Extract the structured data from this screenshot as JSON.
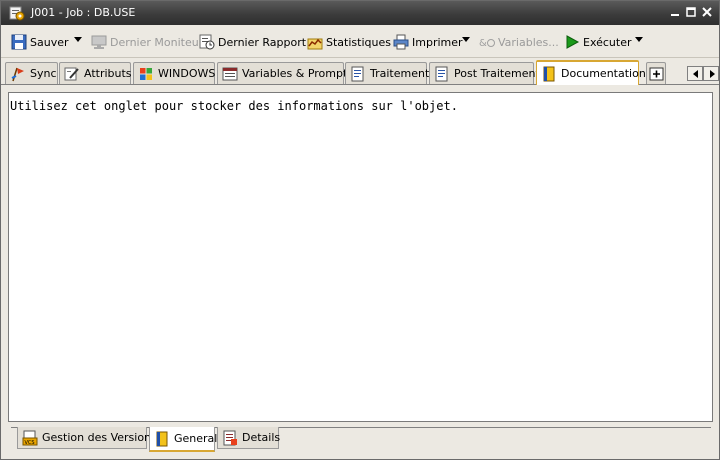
{
  "window": {
    "title": "J001 - Job : DB.USE",
    "controls": [
      "minimize",
      "maximize",
      "close"
    ]
  },
  "toolbar": {
    "save": "Sauver",
    "last_monitor": "Dernier Moniteur",
    "last_report": "Dernier Rapport",
    "statistics": "Statistiques",
    "print": "Imprimer",
    "variables": "Variables...",
    "execute": "Exécuter"
  },
  "tabs": [
    {
      "label": "Sync"
    },
    {
      "label": "Attributs"
    },
    {
      "label": "WINDOWS"
    },
    {
      "label": "Variables & Prompts"
    },
    {
      "label": "Traitement"
    },
    {
      "label": "Post Traitement"
    },
    {
      "label": "Documentation",
      "active": true
    }
  ],
  "content": {
    "text": "Utilisez cet onglet pour stocker des informations sur l'objet."
  },
  "bottom_tabs": [
    {
      "label": "Gestion des Versions"
    },
    {
      "label": "General",
      "active": true
    },
    {
      "label": "Details"
    }
  ],
  "colors": {
    "title_bar": "#3c3c3c",
    "active_tab_border": "#d8a733",
    "execute_icon": "#1a9a1a"
  }
}
